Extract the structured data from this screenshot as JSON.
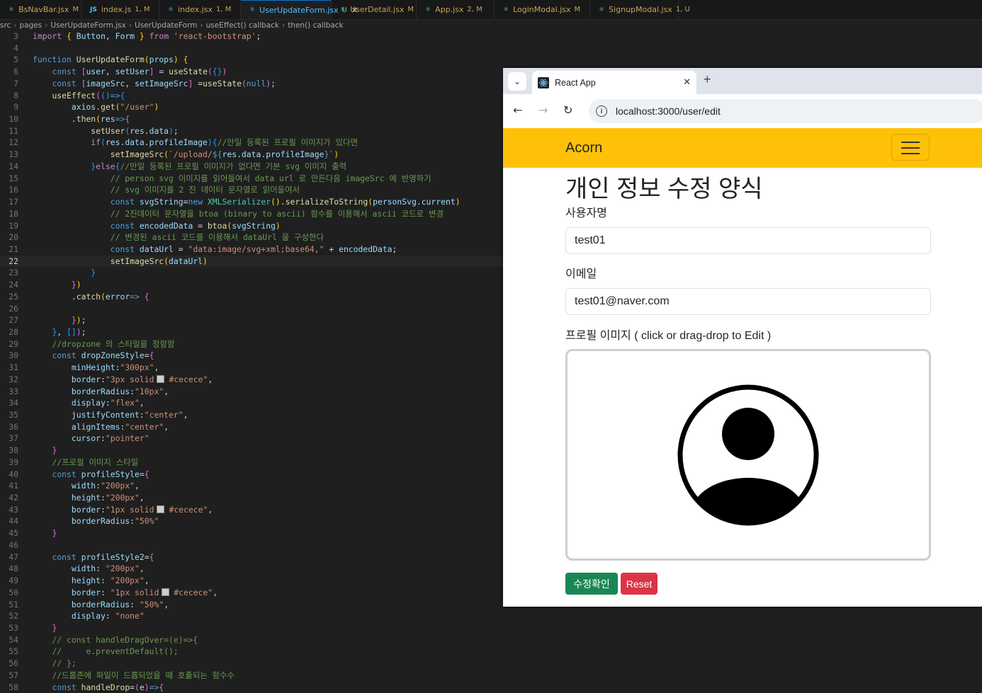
{
  "editor": {
    "tabs": [
      {
        "icon": "",
        "name": "BsNavBar.jsx",
        "status": "M",
        "active": false
      },
      {
        "icon": "JS",
        "name": "index.js",
        "status": "1, M",
        "active": false
      },
      {
        "icon": "",
        "name": "index.jsx",
        "status": "1, M",
        "active": false
      },
      {
        "icon": "",
        "name": "UserUpdateForm.jsx",
        "status": "U",
        "active": true
      },
      {
        "icon": "",
        "name": "UserDetail.jsx",
        "status": "M",
        "active": false
      },
      {
        "icon": "",
        "name": "App.jsx",
        "status": "2, M",
        "active": false
      },
      {
        "icon": "",
        "name": "LoginModal.jsx",
        "status": "M",
        "active": false
      },
      {
        "icon": "",
        "name": "SignupModal.jsx",
        "status": "1, U",
        "active": false
      }
    ],
    "breadcrumbs": [
      "src",
      "pages",
      "UserUpdateForm.jsx",
      "UserUpdateForm",
      "useEffect() callback",
      "then() callback"
    ],
    "current_line": 22,
    "lines": [
      {
        "n": 3,
        "html": "<span class='ctl'>import</span> <span class='br'>{</span> <span class='v'>Button</span>, <span class='v'>Form</span> <span class='br'>}</span> <span class='ctl'>from</span> <span class='s'>'react-bootstrap'</span>;"
      },
      {
        "n": 4,
        "html": ""
      },
      {
        "n": 5,
        "html": "<span class='kw'>function</span> <span class='fn'>UserUpdateForm</span><span class='br'>(</span><span class='v'>props</span><span class='br'>)</span> <span class='br'>{</span>"
      },
      {
        "n": 6,
        "html": "    <span class='kw'>const</span> <span class='br2'>[</span><span class='v'>user</span>, <span class='v'>setUser</span><span class='br2'>]</span> = <span class='fn'>useState</span><span class='br2'>(</span><span class='br3'>{}</span><span class='br2'>)</span>"
      },
      {
        "n": 7,
        "html": "    <span class='kw'>const</span> <span class='br2'>[</span><span class='v'>imageSrc</span>, <span class='v'>setImageSrc</span><span class='br2'>]</span> =<span class='fn'>useState</span><span class='br2'>(</span><span class='kw'>null</span><span class='br2'>)</span>;"
      },
      {
        "n": 8,
        "html": "    <span class='fn'>useEffect</span><span class='br2'>(</span><span class='br3'>()</span><span class='kw'>=&gt;</span><span class='br3'>{</span>"
      },
      {
        "n": 9,
        "html": "        <span class='v'>axios</span>.<span class='fn'>get</span><span class='br'>(</span><span class='s'>\"/user\"</span><span class='br'>)</span>"
      },
      {
        "n": 10,
        "html": "        .<span class='fn'>then</span><span class='br'>(</span><span class='v'>res</span><span class='kw'>=&gt;</span><span class='br2'>{</span>"
      },
      {
        "n": 11,
        "html": "            <span class='fn'>setUser</span><span class='br3'>(</span><span class='v'>res</span>.<span class='v'>data</span><span class='br3'>)</span>;"
      },
      {
        "n": 12,
        "html": "            <span class='ctl'>if</span><span class='br3'>(</span><span class='v'>res</span>.<span class='v'>data</span>.<span class='v'>profileImage</span><span class='br3'>){</span><span class='cm'>//만일 등록된 프로필 이미지가 있다면</span>"
      },
      {
        "n": 13,
        "html": "                <span class='fn'>setImageSrc</span><span class='br'>(</span><span class='s'>`/upload/</span><span class='kw'>${</span><span class='v'>res</span>.<span class='v'>data</span>.<span class='v'>profileImage</span><span class='kw'>}</span><span class='s'>`</span><span class='br'>)</span>"
      },
      {
        "n": 14,
        "html": "            <span class='br3'>}</span><span class='ctl'>else</span><span class='br3'>{</span><span class='cm'>//만일 등록된 프로필 이미지가 없다면 기본 svg 이미지 출력</span>"
      },
      {
        "n": 15,
        "html": "                <span class='cm'>// person svg 이미지를 읽어들여서 data url 로 만든다음 imageSrc 에 반영하기</span>"
      },
      {
        "n": 16,
        "html": "                <span class='cm'>// svg 이미지를 2 진 데이터 문자열로 읽어들여서</span>"
      },
      {
        "n": 17,
        "html": "                <span class='kw'>const</span> <span class='v'>svgString</span>=<span class='kw'>new</span> <span class='cls'>XMLSerializer</span><span class='br'>()</span>.<span class='fn'>serializeToString</span><span class='br'>(</span><span class='v'>personSvg</span>.<span class='v'>current</span><span class='br'>)</span>"
      },
      {
        "n": 18,
        "html": "                <span class='cm'>// 2진데이터 문자열을 btoa (binary to ascii) 함수를 이용해서 ascii 코드로 변경</span>"
      },
      {
        "n": 19,
        "html": "                <span class='kw'>const</span> <span class='v'>encodedData</span> = <span class='fn'>btoa</span><span class='br'>(</span><span class='v'>svgString</span><span class='br'>)</span>"
      },
      {
        "n": 20,
        "html": "                <span class='cm'>// 변경된 ascii 코드를 이용해서 dataUrl 을 구성한다</span>"
      },
      {
        "n": 21,
        "html": "                <span class='kw'>const</span> <span class='v'>dataUrl</span> = <span class='s'>\"data:image/svg+xml;base64,\"</span> + <span class='v'>encodedData</span>;"
      },
      {
        "n": 22,
        "html": "                <span class='fn'>setImageSrc</span><span class='br'>(</span><span class='v'>dataUrl</span><span class='br'>)</span>"
      },
      {
        "n": 23,
        "html": "            <span class='br3'>}</span>"
      },
      {
        "n": 24,
        "html": "        <span class='br2'>}</span><span class='br'>)</span>"
      },
      {
        "n": 25,
        "html": "        .<span class='fn'>catch</span><span class='br'>(</span><span class='v'>error</span><span class='kw'>=&gt;</span> <span class='br2'>{</span>"
      },
      {
        "n": 26,
        "html": ""
      },
      {
        "n": 27,
        "html": "        <span class='br2'>}</span><span class='br'>)</span>;"
      },
      {
        "n": 28,
        "html": "    <span class='br3'>}</span>, <span class='br3'>[]</span><span class='br2'>)</span>;"
      },
      {
        "n": 29,
        "html": "    <span class='cm'>//dropzone 의 스타일을 정함함</span>"
      },
      {
        "n": 30,
        "html": "    <span class='kw'>const</span> <span class='v'>dropZoneStyle</span>=<span class='br2'>{</span>"
      },
      {
        "n": 31,
        "html": "        <span class='v'>minHeight</span>:<span class='s'>\"300px\"</span>,"
      },
      {
        "n": 32,
        "html": "        <span class='v'>border</span>:<span class='s'>\"3px solid<span class='sw'></span>#cecece\"</span>,"
      },
      {
        "n": 33,
        "html": "        <span class='v'>borderRadius</span>:<span class='s'>\"10px\"</span>,"
      },
      {
        "n": 34,
        "html": "        <span class='v'>display</span>:<span class='s'>\"flex\"</span>,"
      },
      {
        "n": 35,
        "html": "        <span class='v'>justifyContent</span>:<span class='s'>\"center\"</span>,"
      },
      {
        "n": 36,
        "html": "        <span class='v'>alignItems</span>:<span class='s'>\"center\"</span>,"
      },
      {
        "n": 37,
        "html": "        <span class='v'>cursor</span>:<span class='s'>\"pointer\"</span>"
      },
      {
        "n": 38,
        "html": "    <span class='br2'>}</span>"
      },
      {
        "n": 39,
        "html": "    <span class='cm'>//프로필 이미지 스타일</span>"
      },
      {
        "n": 40,
        "html": "    <span class='kw'>const</span> <span class='v'>profileStyle</span>=<span class='br2'>{</span>"
      },
      {
        "n": 41,
        "html": "        <span class='v'>width</span>:<span class='s'>\"200px\"</span>,"
      },
      {
        "n": 42,
        "html": "        <span class='v'>height</span>:<span class='s'>\"200px\"</span>,"
      },
      {
        "n": 43,
        "html": "        <span class='v'>border</span>:<span class='s'>\"1px solid<span class='sw'></span>#cecece\"</span>,"
      },
      {
        "n": 44,
        "html": "        <span class='v'>borderRadius</span>:<span class='s'>\"50%\"</span>"
      },
      {
        "n": 45,
        "html": "    <span class='br2'>}</span>"
      },
      {
        "n": 46,
        "html": ""
      },
      {
        "n": 47,
        "html": "    <span class='kw'>const</span> <span class='v'>profileStyle2</span>=<span class='br2'>{</span>"
      },
      {
        "n": 48,
        "html": "        <span class='v'>width</span>: <span class='s'>\"200px\"</span>,"
      },
      {
        "n": 49,
        "html": "        <span class='v'>height</span>: <span class='s'>\"200px\"</span>,"
      },
      {
        "n": 50,
        "html": "        <span class='v'>border</span>: <span class='s'>\"1px solid<span class='sw'></span>#cecece\"</span>,"
      },
      {
        "n": 51,
        "html": "        <span class='v'>borderRadius</span>: <span class='s'>\"50%\"</span>,"
      },
      {
        "n": 52,
        "html": "        <span class='v'>display</span>: <span class='s'>\"none\"</span>"
      },
      {
        "n": 53,
        "html": "    <span class='br2'>}</span>"
      },
      {
        "n": 54,
        "html": "    <span class='cm'>// const handleDragOver=(e)=&gt;{</span>"
      },
      {
        "n": 55,
        "html": "    <span class='cm'>//     e.preventDefault();</span>"
      },
      {
        "n": 56,
        "html": "    <span class='cm'>// };</span>"
      },
      {
        "n": 57,
        "html": "    <span class='cm'>//드롭존에 파일이 드롭되었을 때 호출되는 함수수</span>"
      },
      {
        "n": 58,
        "html": "    <span class='kw'>const</span> <span class='fn'>handleDrop</span>=<span class='br2'>(</span><span class='v'>e</span><span class='br2'>)</span><span class='kw'>=&gt;</span><span class='br2'>{</span>"
      }
    ]
  },
  "browser": {
    "tab_title": "React App",
    "url": "localhost:3000/user/edit",
    "tab_search_icon": "chevron-down-icon",
    "new_tab": "+",
    "close_tab": "✕"
  },
  "page": {
    "brand": "Acorn",
    "heading": "개인 정보 수정 양식",
    "username_label": "사용자명",
    "username_value": "test01",
    "email_label": "이메일",
    "email_value": "test01@naver.com",
    "profile_label": "프로필 이미지 ( click or drag-drop to Edit )",
    "submit_label": "수정확인",
    "reset_label": "Reset",
    "colors": {
      "navbar": "#ffc107",
      "submit": "#198754",
      "reset": "#dc3545",
      "dropzone_border": "#cecece"
    }
  }
}
